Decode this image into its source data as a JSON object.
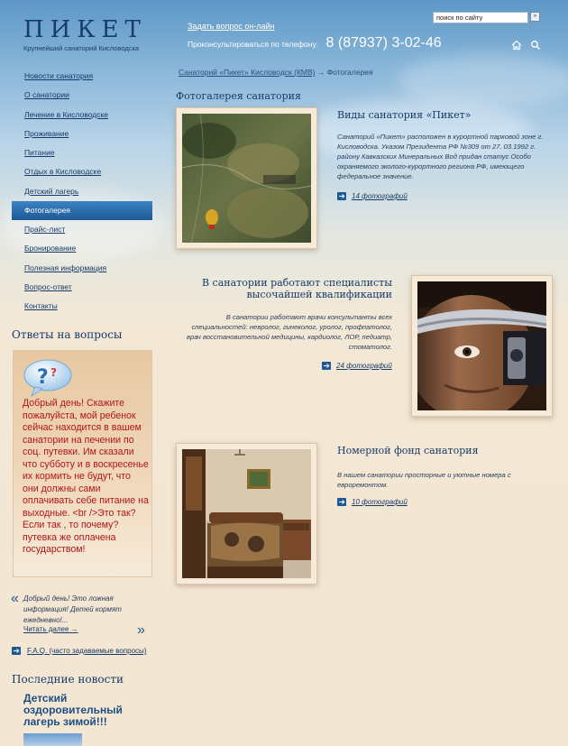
{
  "header": {
    "logo_title": "ПИКЕТ",
    "logo_subtitle": "Крупнейший санаторий Кисловодска",
    "ask_link": "Задать вопрос он-лайн",
    "phone_label": "Проконсультироваться по телефону:",
    "phone_number": "8 (87937) 3-02-46",
    "search_value": "поиск по сайту",
    "search_button": "»"
  },
  "sidebar": {
    "items": [
      {
        "label": "Новости санатория"
      },
      {
        "label": "О санатории"
      },
      {
        "label": "Лечение в Кисловодске"
      },
      {
        "label": "Проживание"
      },
      {
        "label": "Питание"
      },
      {
        "label": "Отдых в Кисловодске"
      },
      {
        "label": "Детский лагерь"
      },
      {
        "label": "Фотогалерея"
      },
      {
        "label": "Прайс-лист"
      },
      {
        "label": "Бронирование"
      },
      {
        "label": "Полезная информация"
      },
      {
        "label": "Вопрос-ответ"
      },
      {
        "label": "Контакты"
      }
    ],
    "qa_heading": "Ответы на вопросы",
    "qa_question": "Добрый день! Скажите пожалуйста, мой ребенок сейчас находится в вашем санатории на печении по соц. путевки. Им сказали что субботу и в воскресенье их кормить не будут, что они должны сами оплачивать себе питание на выходные. <br />Это так?Если так , то почему? путевка же оплачена государством!",
    "quote_open": "«",
    "quote_close": "»",
    "qa_answer": "Добрый день! Это ложная информация! Детей кормят ежедневно!...",
    "read_more": "Читать далее →",
    "faq_link": "F.A.Q. (часто задаваемые вопросы)",
    "news_heading": "Последние новости",
    "news_title": "Детский оздоровительный лагерь зимой!!!"
  },
  "breadcrumb": {
    "link": "Санаторий «Пикет» Кисловодск (КМВ)",
    "current": "→ Фотогалерея"
  },
  "main": {
    "title": "Фотогалерея санатория",
    "sections": [
      {
        "title": "Виды санатория «Пикет»",
        "description": "Санаторий «Пикет» расположен в курортной парковой зоне г. Кисловодска. Указом Президента РФ №309 от 27. 03.1992 г. району Кавказских Минеральных Вод придан статус Особо охраняемого эколого-курортного региона РФ, имеющего федеральное значение.",
        "photos": "14 фотографий"
      },
      {
        "title": "В санатории работают специалисты высочайшей квалификации",
        "description": "В санатории работают врачи консультанты всех специальностей: невролог, гинеколог, уролог, профпатолог, врач восстановительной медицины, кардиолог, ЛОР, педиатр, стоматолог.",
        "photos": "24 фотографий"
      },
      {
        "title": "Номерной фонд санатория",
        "description": "В нашем санатории просторные и уютные номера с евроремонтом.",
        "photos": "10 фотографий"
      }
    ]
  },
  "colors": {
    "accent": "#1d5896",
    "link": "#173a68",
    "question_text": "#b01616"
  },
  "icons": [
    "home-icon",
    "search-icon",
    "arrow-right-icon",
    "question-bubble-icon"
  ]
}
